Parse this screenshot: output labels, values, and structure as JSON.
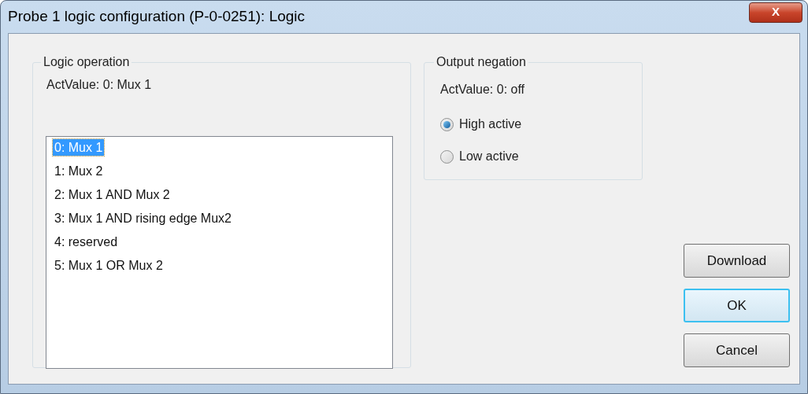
{
  "window": {
    "title": "Probe 1 logic configuration (P-0-0251): Logic",
    "close": "X"
  },
  "logic_operation": {
    "title": "Logic operation",
    "act_value": "ActValue: 0: Mux 1",
    "items": [
      {
        "label": "0: Mux 1",
        "selected": true
      },
      {
        "label": "1: Mux 2",
        "selected": false
      },
      {
        "label": "2: Mux 1 AND Mux 2",
        "selected": false
      },
      {
        "label": "3: Mux 1 AND rising edge Mux2",
        "selected": false
      },
      {
        "label": "4: reserved",
        "selected": false
      },
      {
        "label": "5: Mux 1 OR Mux 2",
        "selected": false
      }
    ]
  },
  "output_negation": {
    "title": "Output negation",
    "act_value": "ActValue: 0: off",
    "options": [
      {
        "label": "High active",
        "selected": true
      },
      {
        "label": "Low active",
        "selected": false
      }
    ]
  },
  "buttons": [
    {
      "label": "Download",
      "default": false
    },
    {
      "label": "OK",
      "default": true
    },
    {
      "label": "Cancel",
      "default": false
    }
  ]
}
